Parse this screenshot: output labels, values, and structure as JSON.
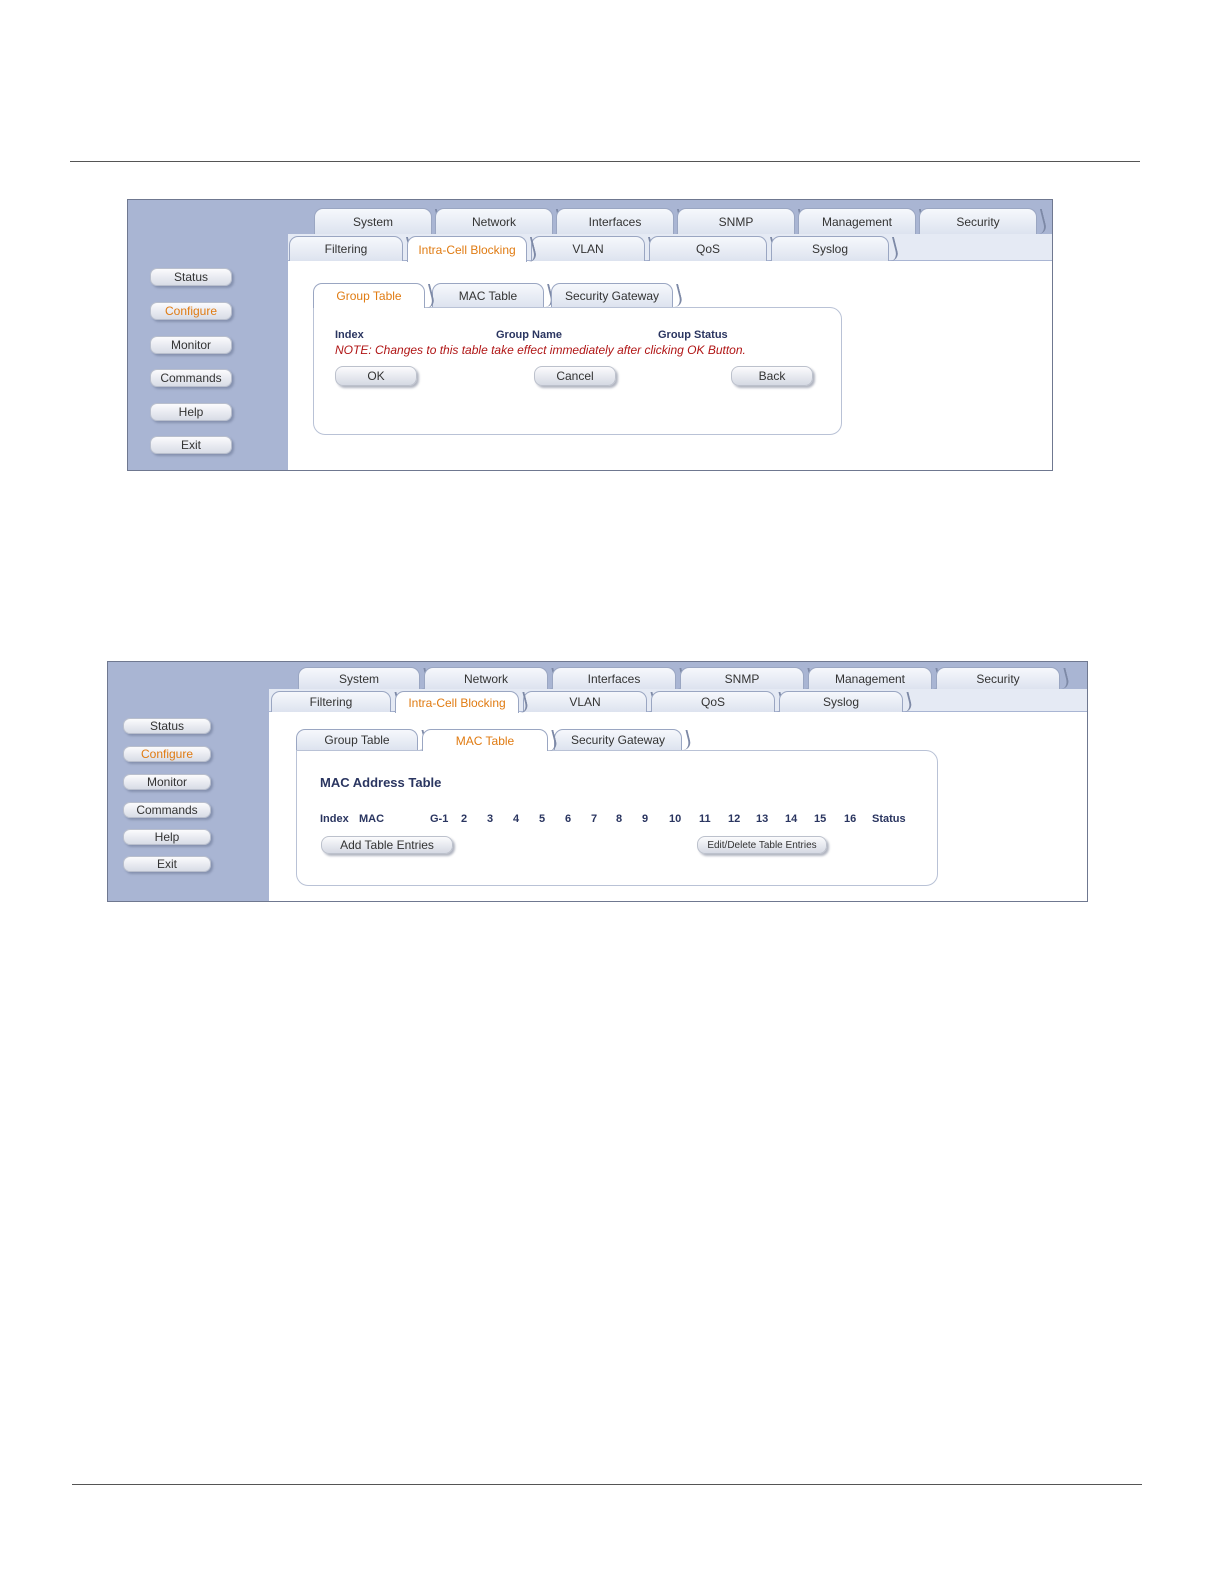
{
  "top_tabs": [
    "System",
    "Network",
    "Interfaces",
    "SNMP",
    "Management",
    "Security"
  ],
  "sub_tabs": [
    "Filtering",
    "Intra-Cell Blocking",
    "VLAN",
    "QoS",
    "Syslog"
  ],
  "sub_active": "Intra-Cell Blocking",
  "side_buttons": [
    "Status",
    "Configure",
    "Monitor",
    "Commands",
    "Help",
    "Exit"
  ],
  "side_active": "Configure",
  "inner_tabs": [
    "Group Table",
    "MAC Table",
    "Security Gateway"
  ],
  "screenshot1": {
    "active_inner_tab": "Group Table",
    "headers": {
      "index": "Index",
      "group_name": "Group Name",
      "group_status": "Group Status"
    },
    "note": "NOTE: Changes to this table take effect immediately after clicking OK Button.",
    "buttons": {
      "ok": "OK",
      "cancel": "Cancel",
      "back": "Back"
    }
  },
  "screenshot2": {
    "active_inner_tab": "MAC Table",
    "title": "MAC Address Table",
    "columns": [
      "Index",
      "MAC",
      "G-1",
      "2",
      "3",
      "4",
      "5",
      "6",
      "7",
      "8",
      "9",
      "10",
      "11",
      "12",
      "13",
      "14",
      "15",
      "16",
      "Status"
    ],
    "buttons": {
      "add": "Add Table Entries",
      "edit_delete": "Edit/Delete Table Entries"
    }
  },
  "colors": {
    "accent": "#e07b12",
    "sidebar": "#a9b5d3",
    "note": "#b01515",
    "label": "#2a3560"
  }
}
